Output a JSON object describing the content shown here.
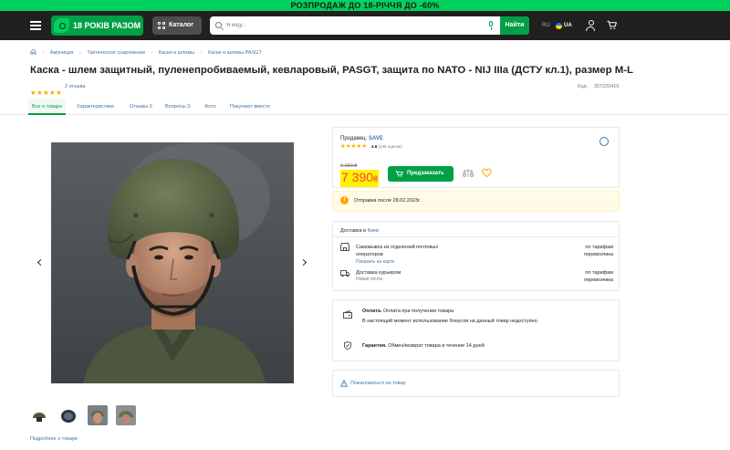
{
  "promo": {
    "text": "РОЗПРОДАЖ ДО 18-РІЧЧЯ ДО -60%",
    "bg": "#00d15e"
  },
  "header": {
    "logo_text": "18 РОКІВ РАЗОМ",
    "catalog_label": "Каталог",
    "search_placeholder": "Я ищу...",
    "search_button": "Найти",
    "lang_ru": "RU",
    "lang_ua": "UA"
  },
  "breadcrumbs": [
    "Амуниция",
    "Тактическое снаряжение",
    "Каски и шлемы",
    "Каски и шлемы PASGT"
  ],
  "product": {
    "title": "Каска - шлем защитный, пуленепробиваемый, кевларовый, PASGT, защита по NATO - NIJ IIIa (ДСТУ кл.1), размер M-L",
    "rating_stars": 5,
    "reviews_link": "2 отзыва",
    "code_label": "Код:",
    "code_value": "357220416"
  },
  "tabs": [
    {
      "label": "Все о товаре",
      "count": ""
    },
    {
      "label": "Характеристики",
      "count": ""
    },
    {
      "label": "Отзывы",
      "count": "2"
    },
    {
      "label": "Вопросы",
      "count": "3"
    },
    {
      "label": "Фото",
      "count": ""
    },
    {
      "label": "Покупают вместе",
      "count": ""
    }
  ],
  "gallery": {
    "more_link": "Подробнее о товаре"
  },
  "seller": {
    "label": "Продавец:",
    "name": "SAVE",
    "rating": "4.8",
    "rating_count": "(246 оценок)"
  },
  "price": {
    "old": "9 090 ₴",
    "current": "7 390",
    "currency": "₴",
    "buy_button": "Предзаказать",
    "accent": "#f84147",
    "highlight": "#fff200"
  },
  "shipping_note": "Отправка после 28.02.2023г.",
  "delivery": {
    "head_label": "Доставка в",
    "city": "Киев",
    "options": [
      {
        "title_line1": "Самовывоз из отделений почтовых",
        "title_line2": "операторов",
        "sub": "Показать на карте",
        "price_line1": "по тарифам",
        "price_line2": "перевозчика"
      },
      {
        "title_line1": "Доставка курьером",
        "title_line2": "",
        "sub": "Новая почта",
        "price_line1": "по тарифам",
        "price_line2": "перевозчика"
      }
    ]
  },
  "payment": {
    "title_bold": "Оплата.",
    "title_rest": "Оплата при получении товара",
    "note": "В настоящий момент использование бонусов на данный товар недоступно."
  },
  "guarantee": {
    "bold": "Гарантия.",
    "rest": "Обмен/возврат товара в течение 14 дней"
  },
  "complain": "Пожаловаться на товар",
  "colors": {
    "brand_green": "#00a046",
    "header_bg": "#221f1f",
    "link": "#3e77aa",
    "star": "#ffa900"
  }
}
